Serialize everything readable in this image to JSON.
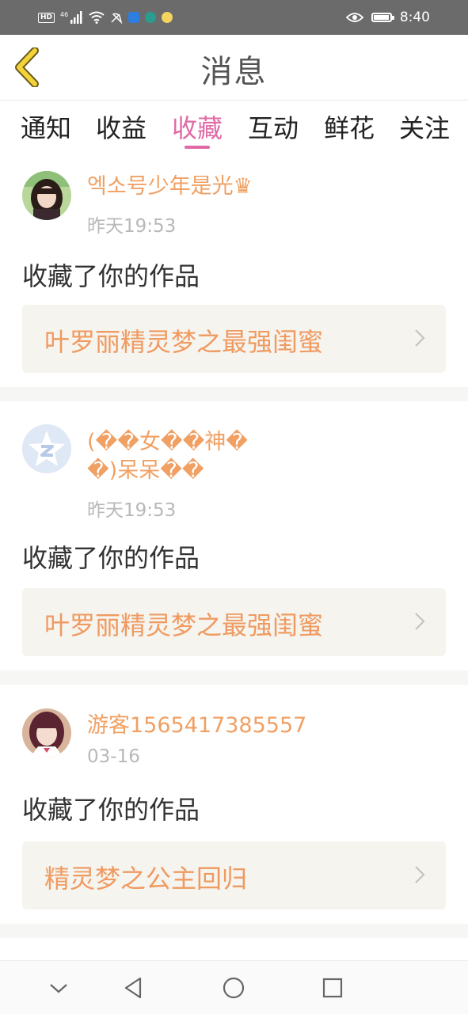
{
  "status_bar": {
    "left_badge": "HD",
    "network": "46",
    "time": "8:40"
  },
  "header": {
    "title": "消息"
  },
  "tabs": [
    {
      "label": "通知"
    },
    {
      "label": "收益"
    },
    {
      "label": "收藏",
      "active": true
    },
    {
      "label": "互动"
    },
    {
      "label": "鲜花"
    },
    {
      "label": "关注"
    }
  ],
  "notifications": [
    {
      "username": "엑소号少年是光♛",
      "time": "昨天19:53",
      "action": "收藏了你的作品",
      "work_title": "叶罗丽精灵梦之最强闺蜜"
    },
    {
      "username": "(��女��神��)呆呆��",
      "time": "昨天19:53",
      "action": "收藏了你的作品",
      "work_title": "叶罗丽精灵梦之最强闺蜜"
    },
    {
      "username": "游客1565417385557",
      "time": "03-16",
      "action": "收藏了你的作品",
      "work_title": "精灵梦之公主回归"
    }
  ],
  "colors": {
    "accent_pink": "#e06aa5",
    "username_orange": "#f0a063",
    "work_title_orange": "#f09a60",
    "back_arrow_yellow": "#f2d33a"
  }
}
